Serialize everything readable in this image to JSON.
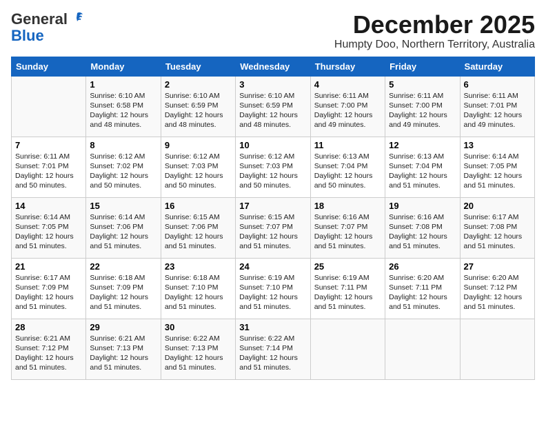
{
  "logo": {
    "general": "General",
    "blue": "Blue"
  },
  "title": "December 2025",
  "location": "Humpty Doo, Northern Territory, Australia",
  "headers": [
    "Sunday",
    "Monday",
    "Tuesday",
    "Wednesday",
    "Thursday",
    "Friday",
    "Saturday"
  ],
  "weeks": [
    [
      {
        "day": "",
        "info": ""
      },
      {
        "day": "1",
        "info": "Sunrise: 6:10 AM\nSunset: 6:58 PM\nDaylight: 12 hours\nand 48 minutes."
      },
      {
        "day": "2",
        "info": "Sunrise: 6:10 AM\nSunset: 6:59 PM\nDaylight: 12 hours\nand 48 minutes."
      },
      {
        "day": "3",
        "info": "Sunrise: 6:10 AM\nSunset: 6:59 PM\nDaylight: 12 hours\nand 48 minutes."
      },
      {
        "day": "4",
        "info": "Sunrise: 6:11 AM\nSunset: 7:00 PM\nDaylight: 12 hours\nand 49 minutes."
      },
      {
        "day": "5",
        "info": "Sunrise: 6:11 AM\nSunset: 7:00 PM\nDaylight: 12 hours\nand 49 minutes."
      },
      {
        "day": "6",
        "info": "Sunrise: 6:11 AM\nSunset: 7:01 PM\nDaylight: 12 hours\nand 49 minutes."
      }
    ],
    [
      {
        "day": "7",
        "info": "Sunrise: 6:11 AM\nSunset: 7:01 PM\nDaylight: 12 hours\nand 50 minutes."
      },
      {
        "day": "8",
        "info": "Sunrise: 6:12 AM\nSunset: 7:02 PM\nDaylight: 12 hours\nand 50 minutes."
      },
      {
        "day": "9",
        "info": "Sunrise: 6:12 AM\nSunset: 7:03 PM\nDaylight: 12 hours\nand 50 minutes."
      },
      {
        "day": "10",
        "info": "Sunrise: 6:12 AM\nSunset: 7:03 PM\nDaylight: 12 hours\nand 50 minutes."
      },
      {
        "day": "11",
        "info": "Sunrise: 6:13 AM\nSunset: 7:04 PM\nDaylight: 12 hours\nand 50 minutes."
      },
      {
        "day": "12",
        "info": "Sunrise: 6:13 AM\nSunset: 7:04 PM\nDaylight: 12 hours\nand 51 minutes."
      },
      {
        "day": "13",
        "info": "Sunrise: 6:14 AM\nSunset: 7:05 PM\nDaylight: 12 hours\nand 51 minutes."
      }
    ],
    [
      {
        "day": "14",
        "info": "Sunrise: 6:14 AM\nSunset: 7:05 PM\nDaylight: 12 hours\nand 51 minutes."
      },
      {
        "day": "15",
        "info": "Sunrise: 6:14 AM\nSunset: 7:06 PM\nDaylight: 12 hours\nand 51 minutes."
      },
      {
        "day": "16",
        "info": "Sunrise: 6:15 AM\nSunset: 7:06 PM\nDaylight: 12 hours\nand 51 minutes."
      },
      {
        "day": "17",
        "info": "Sunrise: 6:15 AM\nSunset: 7:07 PM\nDaylight: 12 hours\nand 51 minutes."
      },
      {
        "day": "18",
        "info": "Sunrise: 6:16 AM\nSunset: 7:07 PM\nDaylight: 12 hours\nand 51 minutes."
      },
      {
        "day": "19",
        "info": "Sunrise: 6:16 AM\nSunset: 7:08 PM\nDaylight: 12 hours\nand 51 minutes."
      },
      {
        "day": "20",
        "info": "Sunrise: 6:17 AM\nSunset: 7:08 PM\nDaylight: 12 hours\nand 51 minutes."
      }
    ],
    [
      {
        "day": "21",
        "info": "Sunrise: 6:17 AM\nSunset: 7:09 PM\nDaylight: 12 hours\nand 51 minutes."
      },
      {
        "day": "22",
        "info": "Sunrise: 6:18 AM\nSunset: 7:09 PM\nDaylight: 12 hours\nand 51 minutes."
      },
      {
        "day": "23",
        "info": "Sunrise: 6:18 AM\nSunset: 7:10 PM\nDaylight: 12 hours\nand 51 minutes."
      },
      {
        "day": "24",
        "info": "Sunrise: 6:19 AM\nSunset: 7:10 PM\nDaylight: 12 hours\nand 51 minutes."
      },
      {
        "day": "25",
        "info": "Sunrise: 6:19 AM\nSunset: 7:11 PM\nDaylight: 12 hours\nand 51 minutes."
      },
      {
        "day": "26",
        "info": "Sunrise: 6:20 AM\nSunset: 7:11 PM\nDaylight: 12 hours\nand 51 minutes."
      },
      {
        "day": "27",
        "info": "Sunrise: 6:20 AM\nSunset: 7:12 PM\nDaylight: 12 hours\nand 51 minutes."
      }
    ],
    [
      {
        "day": "28",
        "info": "Sunrise: 6:21 AM\nSunset: 7:12 PM\nDaylight: 12 hours\nand 51 minutes."
      },
      {
        "day": "29",
        "info": "Sunrise: 6:21 AM\nSunset: 7:13 PM\nDaylight: 12 hours\nand 51 minutes."
      },
      {
        "day": "30",
        "info": "Sunrise: 6:22 AM\nSunset: 7:13 PM\nDaylight: 12 hours\nand 51 minutes."
      },
      {
        "day": "31",
        "info": "Sunrise: 6:22 AM\nSunset: 7:14 PM\nDaylight: 12 hours\nand 51 minutes."
      },
      {
        "day": "",
        "info": ""
      },
      {
        "day": "",
        "info": ""
      },
      {
        "day": "",
        "info": ""
      }
    ]
  ]
}
